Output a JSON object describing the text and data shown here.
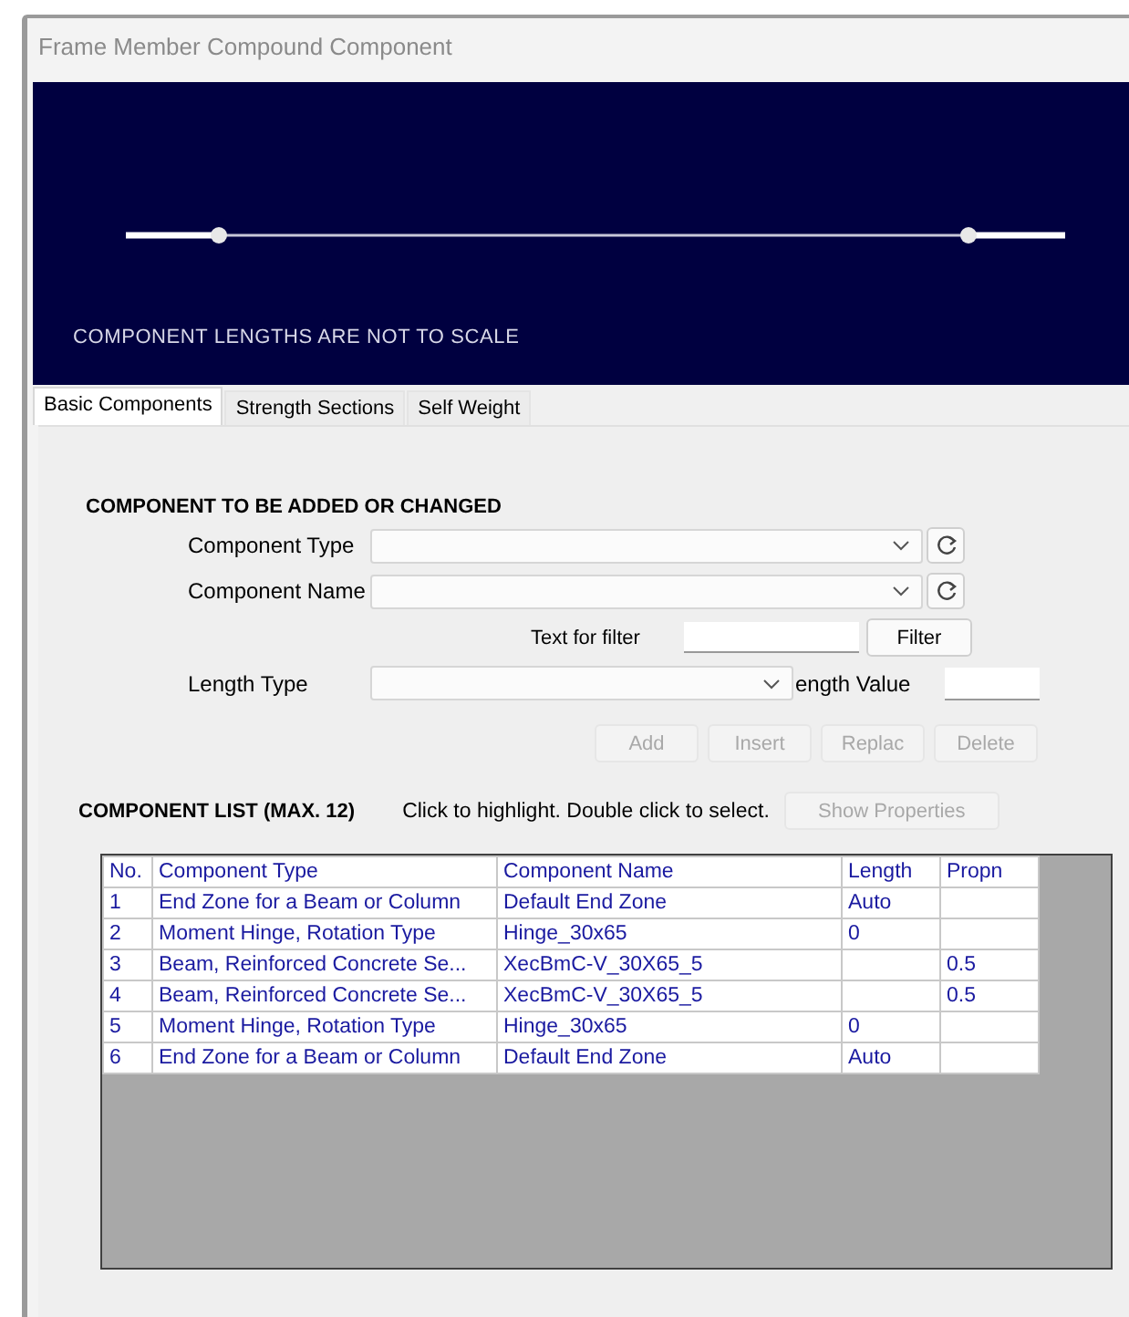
{
  "window": {
    "title": "Frame Member Compound Component"
  },
  "preview": {
    "note": "COMPONENT LENGTHS ARE NOT TO SCALE"
  },
  "tabs": [
    {
      "label": "Basic Components",
      "selected": true
    },
    {
      "label": "Strength Sections",
      "selected": false
    },
    {
      "label": "Self Weight",
      "selected": false
    }
  ],
  "editor": {
    "heading": "COMPONENT TO BE ADDED OR CHANGED",
    "component_type_label": "Component Type",
    "component_name_label": "Component Name",
    "filter_label": "Text for filter",
    "filter_button": "Filter",
    "length_type_label": "Length Type",
    "length_value_label": "ength Value",
    "buttons": [
      {
        "label": "Add",
        "disabled": true
      },
      {
        "label": "Insert",
        "disabled": true
      },
      {
        "label": "Replac",
        "disabled": true
      },
      {
        "label": "Delete",
        "disabled": true
      }
    ]
  },
  "list": {
    "heading": "COMPONENT LIST (MAX. 12)",
    "hint": "Click to highlight.  Double click to select.",
    "show_properties": {
      "label": "Show Properties",
      "disabled": true
    }
  },
  "table": {
    "columns": [
      "No.",
      "Component Type",
      "Component Name",
      "Length",
      "Propn"
    ],
    "rows": [
      [
        "1",
        "End Zone for a Beam or Column",
        "Default End Zone",
        "Auto",
        ""
      ],
      [
        "2",
        "Moment Hinge, Rotation Type",
        "Hinge_30x65",
        "0",
        ""
      ],
      [
        "3",
        "Beam, Reinforced Concrete Se...",
        "XecBmC-V_30X65_5",
        "",
        "0.5"
      ],
      [
        "4",
        "Beam, Reinforced Concrete Se...",
        "XecBmC-V_30X65_5",
        "",
        "0.5"
      ],
      [
        "5",
        "Moment Hinge, Rotation Type",
        "Hinge_30x65",
        "0",
        ""
      ],
      [
        "6",
        "End Zone for a Beam or Column",
        "Default End Zone",
        "Auto",
        ""
      ]
    ]
  }
}
